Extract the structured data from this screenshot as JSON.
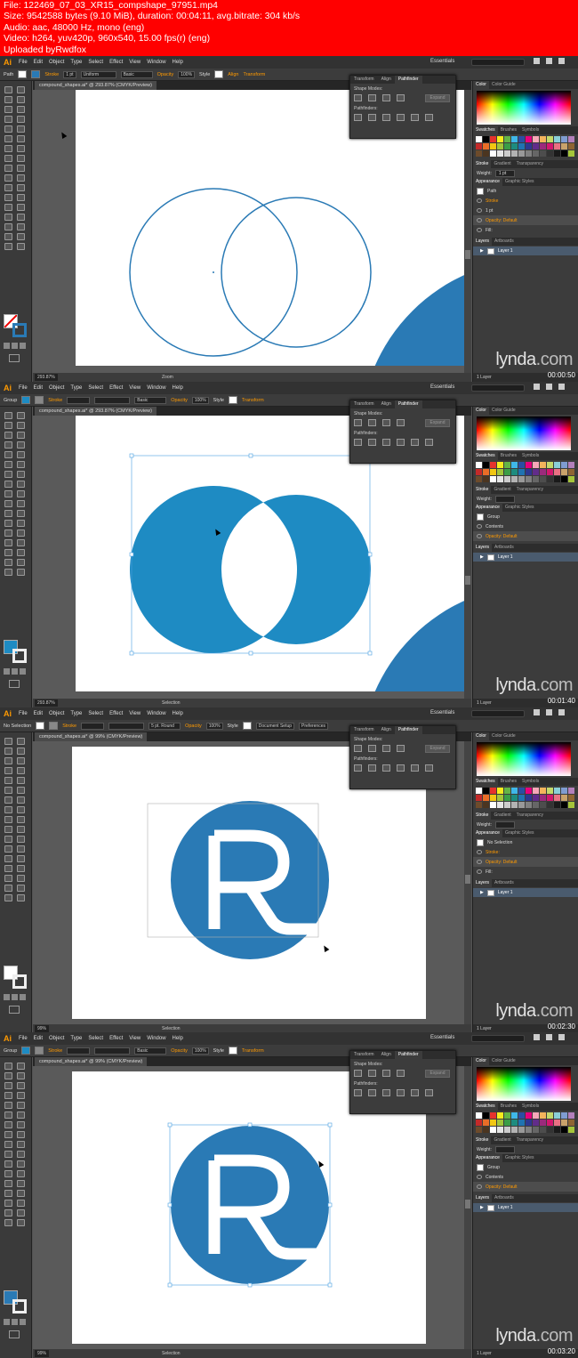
{
  "header": {
    "lines": [
      "File: 122469_07_03_XR15_compshape_97951.mp4",
      "Size: 9542588 bytes (9.10 MiB), duration: 00:04:11, avg.bitrate: 304 kb/s",
      "Audio: aac, 48000 Hz, mono (eng)",
      "Video: h264, yuv420p, 960x540, 15.00 fps(r) (eng)",
      "Uploaded byRwdfox"
    ]
  },
  "app": {
    "logo": "Ai",
    "menus": [
      "File",
      "Edit",
      "Object",
      "Type",
      "Select",
      "Effect",
      "View",
      "Window",
      "Help"
    ],
    "workspace": "Essentials",
    "watermark": "lynda",
    "watermark_domain": ".com"
  },
  "colors": {
    "brand_blue": "#2a7ab5",
    "fill_blue": "#1e8bc3",
    "accent": "#ff9a00",
    "red": "#ff0000"
  },
  "frames": [
    {
      "timestamp": "00:00:50",
      "control": {
        "type": "Path",
        "stroke_label": "Stroke",
        "stroke_weight": "1 pt",
        "profile": "Uniform",
        "brush": "Basic",
        "opacity_label": "Opacity",
        "opacity": "100%",
        "style_label": "Style",
        "align": "Align",
        "transform": "Transform"
      },
      "doc_tab": "compound_shapes.ai* @ 293.87% (CMYK/Preview)",
      "zoom": "293.87%",
      "status_tool": "Zoom",
      "pathfinder": {
        "tabs": [
          "Transform",
          "Align",
          "Pathfinder"
        ],
        "shape_modes": "Shape Modes:",
        "pathfinders": "Pathfinders:",
        "expand": "Expand"
      },
      "panels": {
        "color_tabs": [
          "Color",
          "Color Guide"
        ],
        "swatch_tabs": [
          "Swatches",
          "Brushes",
          "Symbols"
        ],
        "stroke_tabs": [
          "Stroke",
          "Gradient",
          "Transparency"
        ],
        "weight_label": "Weight:",
        "weight": "1 pt",
        "appearance_tabs": [
          "Appearance",
          "Graphic Styles"
        ],
        "rows": [
          "Path",
          "Stroke",
          "1 pt",
          "Opacity: Default",
          "Fill:"
        ],
        "layer_tabs": [
          "Layers",
          "Artboards"
        ],
        "layer": "Layer 1",
        "layer_count": "1 Layer"
      }
    },
    {
      "timestamp": "00:01:40",
      "control": {
        "type": "Group",
        "stroke_label": "Stroke",
        "brush": "Basic",
        "opacity_label": "Opacity",
        "opacity": "100%",
        "style_label": "Style",
        "transform": "Transform"
      },
      "doc_tab": "compound_shapes.ai* @ 293.87% (CMYK/Preview)",
      "zoom": "293.87%",
      "status_tool": "Selection",
      "pathfinder": {
        "tabs": [
          "Transform",
          "Align",
          "Pathfinder"
        ],
        "shape_modes": "Shape Modes:",
        "pathfinders": "Pathfinders:",
        "expand": "Expand"
      },
      "panels": {
        "color_tabs": [
          "Color",
          "Color Guide"
        ],
        "swatch_tabs": [
          "Swatches",
          "Brushes",
          "Symbols"
        ],
        "stroke_tabs": [
          "Stroke",
          "Gradient",
          "Transparency"
        ],
        "weight_label": "Weight:",
        "weight": "",
        "appearance_tabs": [
          "Appearance",
          "Graphic Styles"
        ],
        "rows": [
          "Group",
          "Contents",
          "Opacity: Default"
        ],
        "layer_tabs": [
          "Layers",
          "Artboards"
        ],
        "layer": "Layer 1",
        "layer_count": "1 Layer"
      }
    },
    {
      "timestamp": "00:02:30",
      "control": {
        "type": "No Selection",
        "stroke_label": "Stroke",
        "brush": "5 pt. Round",
        "opacity_label": "Opacity",
        "opacity": "100%",
        "style_label": "Style",
        "doc_setup": "Document Setup",
        "prefs": "Preferences"
      },
      "doc_tab": "compound_shapes.ai* @ 99% (CMYK/Preview)",
      "zoom": "99%",
      "status_tool": "Selection",
      "pathfinder": {
        "tabs": [
          "Transform",
          "Align",
          "Pathfinder"
        ],
        "shape_modes": "Shape Modes:",
        "pathfinders": "Pathfinders:",
        "expand": "Expand"
      },
      "panels": {
        "color_tabs": [
          "Color",
          "Color Guide"
        ],
        "swatch_tabs": [
          "Swatches",
          "Brushes",
          "Symbols"
        ],
        "stroke_tabs": [
          "Stroke",
          "Gradient",
          "Transparency"
        ],
        "weight_label": "Weight:",
        "weight": "",
        "appearance_tabs": [
          "Appearance",
          "Graphic Styles"
        ],
        "rows": [
          "No Selection",
          "Stroke:",
          "Opacity: Default",
          "Fill:"
        ],
        "layer_tabs": [
          "Layers",
          "Artboards"
        ],
        "layer": "Layer 1",
        "layer_count": "1 Layer"
      }
    },
    {
      "timestamp": "00:03:20",
      "control": {
        "type": "Group",
        "stroke_label": "Stroke",
        "brush": "Basic",
        "opacity_label": "Opacity",
        "opacity": "100%",
        "style_label": "Style",
        "transform": "Transform"
      },
      "doc_tab": "compound_shapes.ai* @ 99% (CMYK/Preview)",
      "zoom": "99%",
      "status_tool": "Selection",
      "pathfinder": {
        "tabs": [
          "Transform",
          "Align",
          "Pathfinder"
        ],
        "shape_modes": "Shape Modes:",
        "pathfinders": "Pathfinders:",
        "expand": "Expand"
      },
      "panels": {
        "color_tabs": [
          "Color",
          "Color Guide"
        ],
        "swatch_tabs": [
          "Swatches",
          "Brushes",
          "Symbols"
        ],
        "stroke_tabs": [
          "Stroke",
          "Gradient",
          "Transparency"
        ],
        "weight_label": "Weight:",
        "weight": "",
        "appearance_tabs": [
          "Appearance",
          "Graphic Styles"
        ],
        "rows": [
          "Group",
          "Contents",
          "Opacity: Default"
        ],
        "layer_tabs": [
          "Layers",
          "Artboards"
        ],
        "layer": "Layer 1",
        "layer_count": "1 Layer"
      }
    }
  ]
}
